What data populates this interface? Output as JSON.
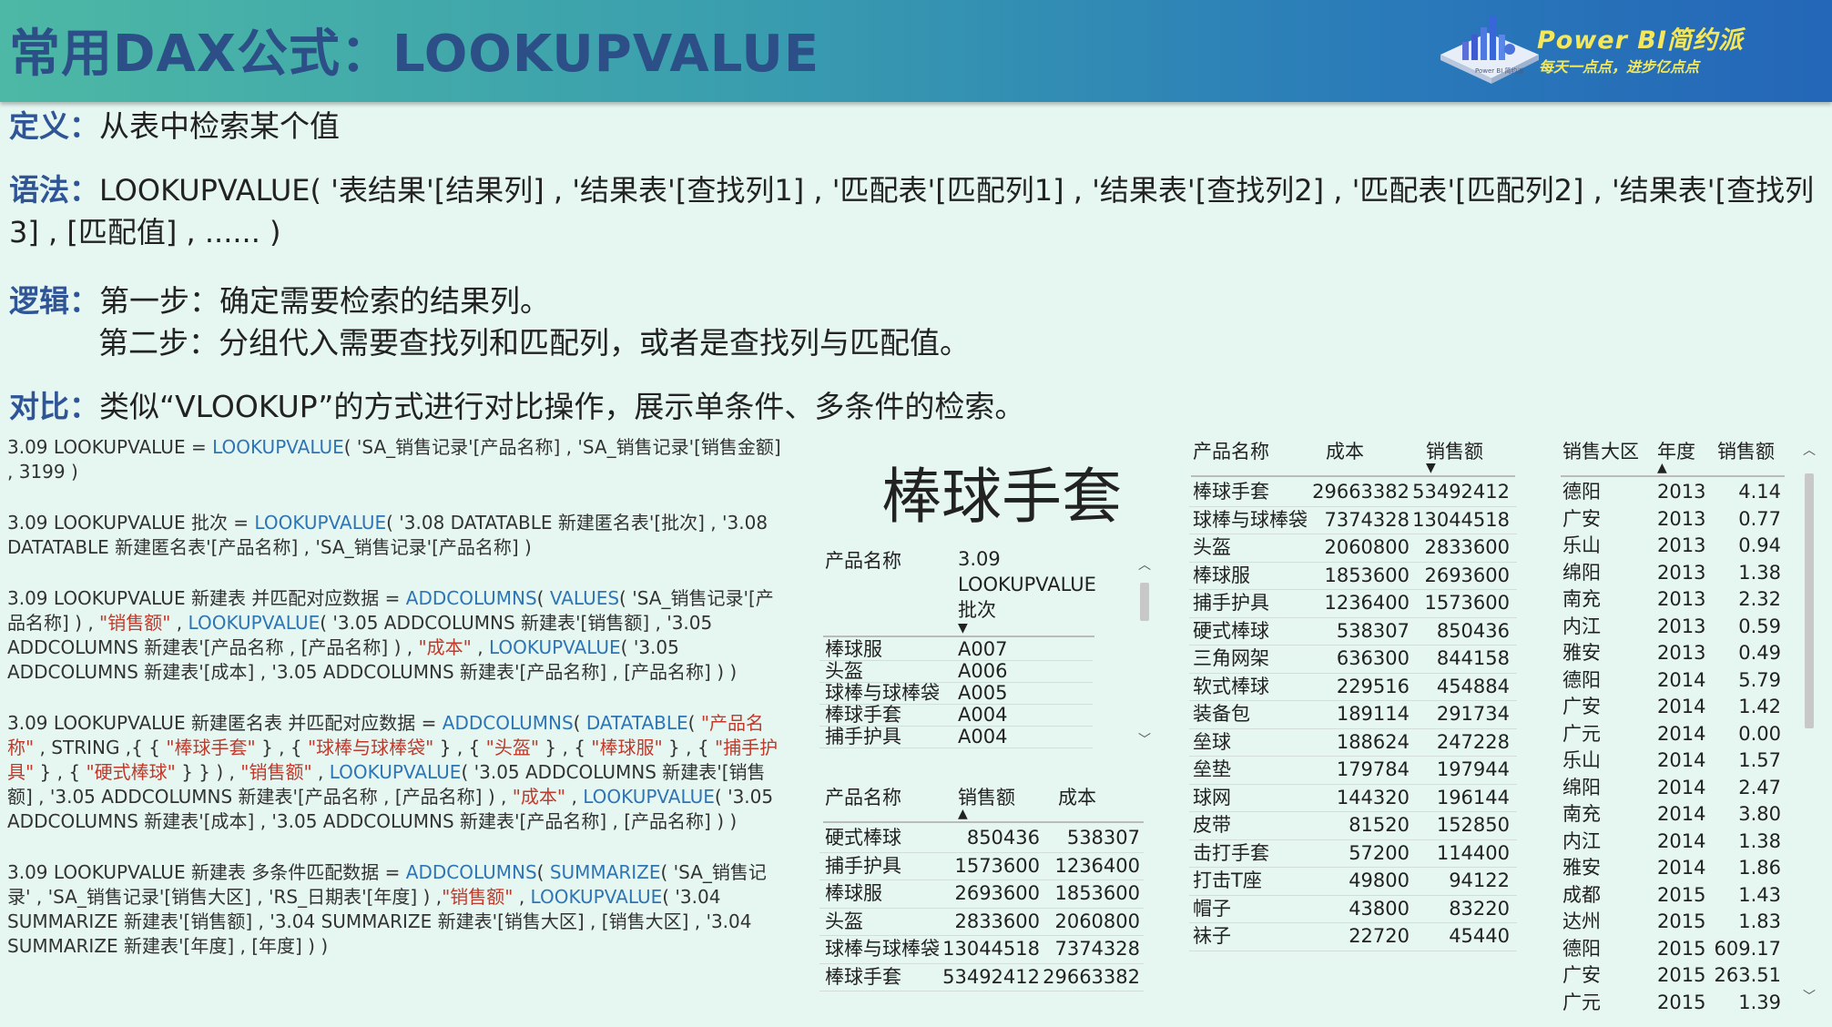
{
  "header": {
    "title": "常用DAX公式：LOOKUPVALUE",
    "brand_line1": "Power  BI简约派",
    "brand_line2": "每天一点点，进步亿点点",
    "logo_caption": "Power BI 简约派"
  },
  "intro": {
    "def_label": "定义：",
    "def_text": "从表中检索某个值",
    "syntax_label": "语法：",
    "syntax_text": "LOOKUPVALUE( '表结果'[结果列] , '结果表'[查找列1] , '匹配表'[匹配列1] , '结果表'[查找列2] , '匹配表'[匹配列2] , '结果表'[查找列3] , [匹配值] , ...... )",
    "logic_label": "逻辑：",
    "logic_step1": "第一步：确定需要检索的结果列。",
    "logic_step2": "第二步：分组代入需要查找列和匹配列，或者是查找列与匹配值。",
    "compare_label": "对比：",
    "compare_text": "类似“VLOOKUP”的方式进行对比操作，展示单条件、多条件的检索。"
  },
  "formulas": [
    [
      {
        "t": "3.09 LOOKUPVALUE = ",
        "k": "n"
      },
      {
        "t": "LOOKUPVALUE",
        "k": "f"
      },
      {
        "t": "( 'SA_销售记录'[产品名称] , 'SA_销售记录'[销售金额] , ",
        "k": "n"
      },
      {
        "t": "3199",
        "k": "n"
      },
      {
        "t": " )",
        "k": "n"
      }
    ],
    [
      {
        "t": "3.09 LOOKUPVALUE 批次 = ",
        "k": "n"
      },
      {
        "t": "LOOKUPVALUE",
        "k": "f"
      },
      {
        "t": "( '3.08 DATATABLE 新建匿名表'[批次] , '3.08 DATATABLE 新建匿名表'[产品名称] , 'SA_销售记录'[产品名称] )",
        "k": "n"
      }
    ],
    [
      {
        "t": "3.09 LOOKUPVALUE 新建表 并匹配对应数据 = ",
        "k": "n"
      },
      {
        "t": "ADDCOLUMNS",
        "k": "f"
      },
      {
        "t": "( ",
        "k": "n"
      },
      {
        "t": "VALUES",
        "k": "f"
      },
      {
        "t": "( 'SA_销售记录'[产品名称] ) , ",
        "k": "n"
      },
      {
        "t": "\"销售额\"",
        "k": "s"
      },
      {
        "t": " , ",
        "k": "n"
      },
      {
        "t": "LOOKUPVALUE",
        "k": "f"
      },
      {
        "t": "( '3.05 ADDCOLUMNS 新建表'[销售额] , '3.05 ADDCOLUMNS 新建表'[产品名称 , [产品名称] ) , ",
        "k": "n"
      },
      {
        "t": "\"成本\"",
        "k": "s"
      },
      {
        "t": " , ",
        "k": "n"
      },
      {
        "t": "LOOKUPVALUE",
        "k": "f"
      },
      {
        "t": "( '3.05 ADDCOLUMNS 新建表'[成本] , '3.05 ADDCOLUMNS 新建表'[产品名称] , [产品名称] ) )",
        "k": "n"
      }
    ],
    [
      {
        "t": "3.09 LOOKUPVALUE 新建匿名表 并匹配对应数据 = ",
        "k": "n"
      },
      {
        "t": "ADDCOLUMNS",
        "k": "f"
      },
      {
        "t": "( ",
        "k": "n"
      },
      {
        "t": "DATATABLE",
        "k": "f"
      },
      {
        "t": "( ",
        "k": "n"
      },
      {
        "t": "\"产品名称\"",
        "k": "s"
      },
      {
        "t": " , STRING ,{ { ",
        "k": "n"
      },
      {
        "t": "\"棒球手套\"",
        "k": "s"
      },
      {
        "t": " } , { ",
        "k": "n"
      },
      {
        "t": "\"球棒与球棒袋\"",
        "k": "s"
      },
      {
        "t": " } , { ",
        "k": "n"
      },
      {
        "t": "\"头盔\"",
        "k": "s"
      },
      {
        "t": " } , { ",
        "k": "n"
      },
      {
        "t": "\"棒球服\"",
        "k": "s"
      },
      {
        "t": " } , { ",
        "k": "n"
      },
      {
        "t": "\"捕手护具\"",
        "k": "s"
      },
      {
        "t": " } , { ",
        "k": "n"
      },
      {
        "t": "\"硬式棒球\"",
        "k": "s"
      },
      {
        "t": " } } ) , ",
        "k": "n"
      },
      {
        "t": "\"销售额\"",
        "k": "s"
      },
      {
        "t": " , ",
        "k": "n"
      },
      {
        "t": "LOOKUPVALUE",
        "k": "f"
      },
      {
        "t": "( '3.05 ADDCOLUMNS 新建表'[销售额] , '3.05 ADDCOLUMNS 新建表'[产品名称 , [产品名称] ) , ",
        "k": "n"
      },
      {
        "t": "\"成本\"",
        "k": "s"
      },
      {
        "t": " , ",
        "k": "n"
      },
      {
        "t": "LOOKUPVALUE",
        "k": "f"
      },
      {
        "t": "( '3.05 ADDCOLUMNS 新建表'[成本] , '3.05 ADDCOLUMNS 新建表'[产品名称] , [产品名称] ) )",
        "k": "n"
      }
    ],
    [
      {
        "t": "3.09 LOOKUPVALUE 新建表 多条件匹配数据 = ",
        "k": "n"
      },
      {
        "t": "ADDCOLUMNS",
        "k": "f"
      },
      {
        "t": "( ",
        "k": "n"
      },
      {
        "t": "SUMMARIZE",
        "k": "f"
      },
      {
        "t": "( 'SA_销售记录' , 'SA_销售记录'[销售大区] , 'RS_日期表'[年度] ) ,",
        "k": "n"
      },
      {
        "t": "\"销售额\"",
        "k": "s"
      },
      {
        "t": "  , ",
        "k": "n"
      },
      {
        "t": "LOOKUPVALUE",
        "k": "f"
      },
      {
        "t": "( '3.04 SUMMARIZE 新建表'[销售额] , '3.04 SUMMARIZE 新建表'[销售大区] , [销售大区] , '3.04 SUMMARIZE 新建表'[年度] , [年度] ) )",
        "k": "n"
      }
    ]
  ],
  "card": {
    "value": "棒球手套"
  },
  "batch_table": {
    "headers": [
      "产品名称",
      "3.09 LOOKUPVALUE 批次"
    ],
    "rows": [
      [
        "棒球服",
        "A007"
      ],
      [
        "头盔",
        "A006"
      ],
      [
        "球棒与球棒袋",
        "A005"
      ],
      [
        "棒球手套",
        "A004"
      ],
      [
        "捕手护具",
        "A004"
      ]
    ]
  },
  "sales_cost_table": {
    "headers": [
      "产品名称",
      "销售额",
      "成本"
    ],
    "rows": [
      [
        "硬式棒球",
        "850436",
        "538307"
      ],
      [
        "捕手护具",
        "1573600",
        "1236400"
      ],
      [
        "棒球服",
        "2693600",
        "1853600"
      ],
      [
        "头盔",
        "2833600",
        "2060800"
      ],
      [
        "球棒与球棒袋",
        "13044518",
        "7374328"
      ],
      [
        "棒球手套",
        "53492412",
        "29663382"
      ]
    ]
  },
  "product_table": {
    "headers": [
      "产品名称",
      "成本",
      "销售额"
    ],
    "rows": [
      [
        "棒球手套",
        "29663382",
        "53492412"
      ],
      [
        "球棒与球棒袋",
        "7374328",
        "13044518"
      ],
      [
        "头盔",
        "2060800",
        "2833600"
      ],
      [
        "棒球服",
        "1853600",
        "2693600"
      ],
      [
        "捕手护具",
        "1236400",
        "1573600"
      ],
      [
        "硬式棒球",
        "538307",
        "850436"
      ],
      [
        "三角网架",
        "636300",
        "844158"
      ],
      [
        "软式棒球",
        "229516",
        "454884"
      ],
      [
        "装备包",
        "189114",
        "291734"
      ],
      [
        "垒球",
        "188624",
        "247228"
      ],
      [
        "垒垫",
        "179784",
        "197944"
      ],
      [
        "球网",
        "144320",
        "196144"
      ],
      [
        "皮带",
        "81520",
        "152850"
      ],
      [
        "击打手套",
        "57200",
        "114400"
      ],
      [
        "打击T座",
        "49800",
        "94122"
      ],
      [
        "帽子",
        "43800",
        "83220"
      ],
      [
        "袜子",
        "22720",
        "45440"
      ]
    ]
  },
  "region_table": {
    "headers": [
      "销售大区",
      "年度",
      "销售额"
    ],
    "rows": [
      [
        "德阳",
        "2013",
        "4.14"
      ],
      [
        "广安",
        "2013",
        "0.77"
      ],
      [
        "乐山",
        "2013",
        "0.94"
      ],
      [
        "绵阳",
        "2013",
        "1.38"
      ],
      [
        "南充",
        "2013",
        "2.32"
      ],
      [
        "内江",
        "2013",
        "0.59"
      ],
      [
        "雅安",
        "2013",
        "0.49"
      ],
      [
        "德阳",
        "2014",
        "5.79"
      ],
      [
        "广安",
        "2014",
        "1.42"
      ],
      [
        "广元",
        "2014",
        "0.00"
      ],
      [
        "乐山",
        "2014",
        "1.57"
      ],
      [
        "绵阳",
        "2014",
        "2.47"
      ],
      [
        "南充",
        "2014",
        "3.80"
      ],
      [
        "内江",
        "2014",
        "1.38"
      ],
      [
        "雅安",
        "2014",
        "1.86"
      ],
      [
        "成都",
        "2015",
        "1.43"
      ],
      [
        "达州",
        "2015",
        "1.83"
      ],
      [
        "德阳",
        "2015",
        "609.17"
      ],
      [
        "广安",
        "2015",
        "263.51"
      ],
      [
        "广元",
        "2015",
        "1.39"
      ]
    ]
  }
}
